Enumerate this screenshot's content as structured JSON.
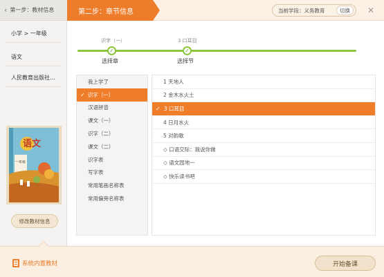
{
  "left": {
    "step1_label": "第一步：教材信息",
    "info": [
      "小学 > 一年级",
      "语文",
      "人民教育出版社..."
    ],
    "book_title": "语文",
    "book_grade": "一年级",
    "edit_label": "修改教材信息"
  },
  "header": {
    "step2_label": "第二步：章节信息",
    "stage_label": "当前学段：义务教育",
    "switch_label": "切换"
  },
  "progress": {
    "chapter_selected": "识字（一）",
    "chapter_caption": "选择章",
    "section_selected": "3 口耳目",
    "section_caption": "选择节"
  },
  "chapters": [
    {
      "label": "我上学了"
    },
    {
      "label": "识字（一）",
      "selected": true
    },
    {
      "label": "汉语拼音"
    },
    {
      "label": "课文（一）"
    },
    {
      "label": "识字（二）"
    },
    {
      "label": "课文（二）"
    },
    {
      "label": "识字表"
    },
    {
      "label": "写字表"
    },
    {
      "label": "常用笔画名称表"
    },
    {
      "label": "常用偏旁名称表"
    }
  ],
  "sections": [
    {
      "label": "1 天地人"
    },
    {
      "label": "2 金木水火土"
    },
    {
      "label": "3 口耳目",
      "selected": true
    },
    {
      "label": "4 日月水火"
    },
    {
      "label": "5 对韵歌"
    },
    {
      "label": "◇ 口语交际：我说你做"
    },
    {
      "label": "◇ 语文园地一"
    },
    {
      "label": "◇ 快乐读书吧"
    }
  ],
  "bottom": {
    "system_label": "系统内置教材",
    "start_label": "开始备课"
  },
  "colors": {
    "accent": "#ee7d2b",
    "progress": "#8cc63e"
  }
}
